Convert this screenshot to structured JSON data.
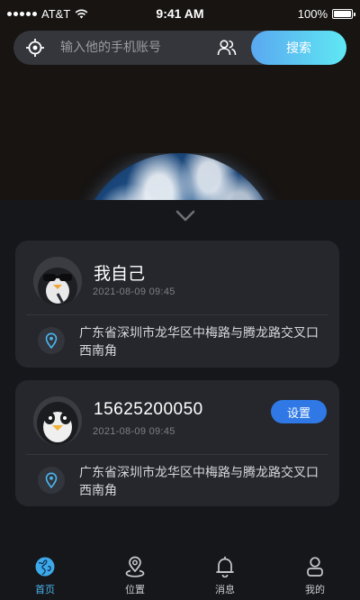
{
  "status_bar": {
    "carrier": "AT&T",
    "time": "9:41 AM",
    "battery": "100%"
  },
  "search": {
    "placeholder": "输入他的手机账号",
    "value": "",
    "button_label": "搜索"
  },
  "cards": [
    {
      "name": "我自己",
      "timestamp": "2021-08-09  09:45",
      "address": "广东省深圳市龙华区中梅路与腾龙路交叉口西南角",
      "avatar_icon": "penguin-sunglasses-avatar"
    },
    {
      "name": "15625200050",
      "timestamp": "2021-08-09  09:45",
      "address": "广东省深圳市龙华区中梅路与腾龙路交叉口西南角",
      "action_label": "设置",
      "avatar_icon": "penguin-avatar"
    }
  ],
  "tabbar": {
    "items": [
      {
        "label": "首页",
        "icon": "globe-icon",
        "active": true
      },
      {
        "label": "位置",
        "icon": "map-pin-icon",
        "active": false
      },
      {
        "label": "消息",
        "icon": "bell-icon",
        "active": false
      },
      {
        "label": "我的",
        "icon": "person-icon",
        "active": false
      }
    ]
  },
  "colors": {
    "background": "#171412",
    "card": "#25272c",
    "accent_blue": "#2f78e6",
    "active_tab": "#4ab5f0",
    "search_gradient_start": "#5aa8f0",
    "search_gradient_end": "#5fe8f3"
  }
}
